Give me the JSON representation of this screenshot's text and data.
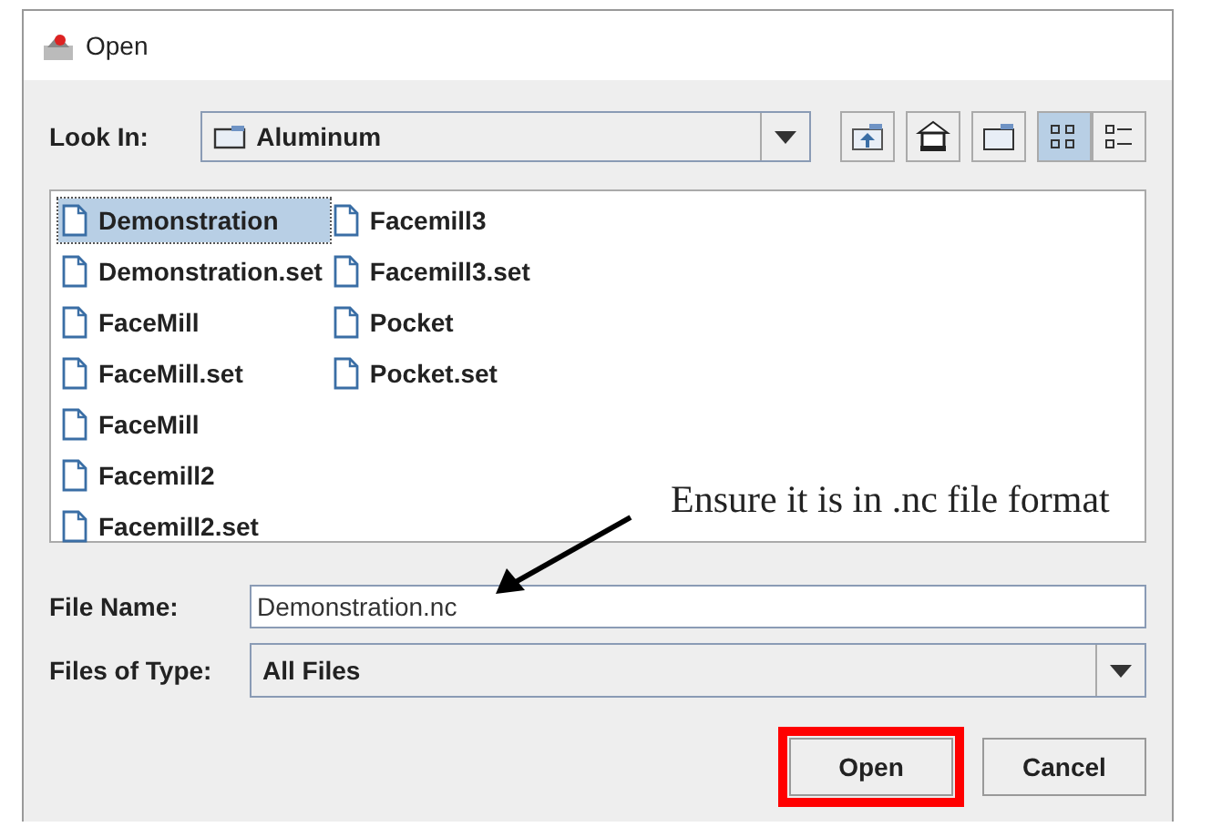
{
  "window": {
    "title": "Open"
  },
  "look_in": {
    "label": "Look In:",
    "value": "Aluminum"
  },
  "toolbar": [
    {
      "kind": "up"
    },
    {
      "kind": "home"
    },
    {
      "kind": "new-folder"
    },
    {
      "kind": "list",
      "selected": true
    },
    {
      "kind": "details",
      "selected": false
    }
  ],
  "files": [
    {
      "name": "Demonstration",
      "selected": true
    },
    {
      "name": "Demonstration.set",
      "selected": false
    },
    {
      "name": "FaceMill",
      "selected": false
    },
    {
      "name": "FaceMill.set",
      "selected": false
    },
    {
      "name": "FaceMill",
      "selected": false
    },
    {
      "name": "Facemill2",
      "selected": false
    },
    {
      "name": "Facemill2.set",
      "selected": false
    },
    {
      "name": "Facemill3",
      "selected": false
    },
    {
      "name": "Facemill3.set",
      "selected": false
    },
    {
      "name": "Pocket",
      "selected": false
    },
    {
      "name": "Pocket.set",
      "selected": false
    }
  ],
  "file_name": {
    "label": "File Name:",
    "value": "Demonstration.nc"
  },
  "file_type": {
    "label": "Files of Type:",
    "value": "All Files"
  },
  "buttons": [
    {
      "label": "Open",
      "highlighted": true
    },
    {
      "label": "Cancel",
      "highlighted": false
    }
  ],
  "annotation": {
    "text": "Ensure it is in .nc file format"
  }
}
